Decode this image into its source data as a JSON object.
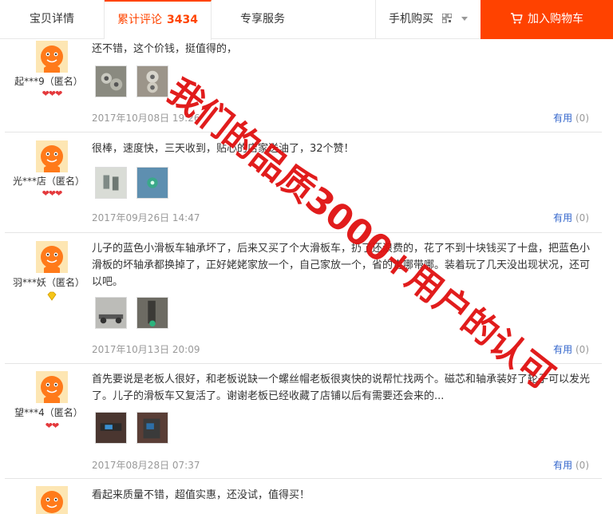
{
  "tabs": {
    "details": "宝贝详情",
    "reviews_label": "累计评论",
    "reviews_count": "3434",
    "service": "专享服务",
    "mobile": "手机购买",
    "cart": "加入购物车"
  },
  "reviews": [
    {
      "user": "起***9（匿名）",
      "rank": "hearts",
      "content": "还不错，这个价钱，挺值得的，",
      "date": "2017年10月08日 19:26",
      "useful_label": "有用",
      "useful_count": "(0)"
    },
    {
      "user": "光***店（匿名）",
      "rank": "hearts",
      "content": "很棒，速度快，三天收到，贴心的店家送油了，32个赞！",
      "date": "2017年09月26日 14:47",
      "useful_label": "有用",
      "useful_count": "(0)"
    },
    {
      "user": "羽***妖（匿名）",
      "rank": "diamond",
      "content": "儿子的蓝色小滑板车轴承坏了，后来又买了个大滑板车，扔了还浪费的，花了不到十块钱买了十盘，把蓝色小滑板的坏轴承都换掉了，正好姥姥家放一个，自己家放一个，省的走哪带哪。装着玩了几天没出现状况，还可以吧。",
      "date": "2017年10月13日 20:09",
      "useful_label": "有用",
      "useful_count": "(0)"
    },
    {
      "user": "望***4（匿名）",
      "rank": "hearts2",
      "content": "首先要说是老板人很好，和老板说缺一个螺丝帽老板很爽快的说帮忙找两个。磁芯和轴承装好了轮子可以发光了。儿子的滑板车又复活了。谢谢老板已经收藏了店铺以后有需要还会来的...",
      "date": "2017年08月28日 07:37",
      "useful_label": "有用",
      "useful_count": "(0)"
    },
    {
      "user": "",
      "rank": "",
      "content": "看起来质量不错，超值实惠，还没试，值得买！",
      "date": "",
      "useful_label": "",
      "useful_count": ""
    }
  ],
  "watermark": "我们的品质3000+用户的认可",
  "colors": {
    "accent": "#ff4400",
    "cart_bg": "#ff4200",
    "link": "#3366cc",
    "watermark": "#e01010"
  },
  "icons": {
    "cart": "cart-icon",
    "qr": "qr-code-icon",
    "avatar": "avatar-icon",
    "heart": "heart-icon",
    "diamond": "diamond-icon"
  }
}
